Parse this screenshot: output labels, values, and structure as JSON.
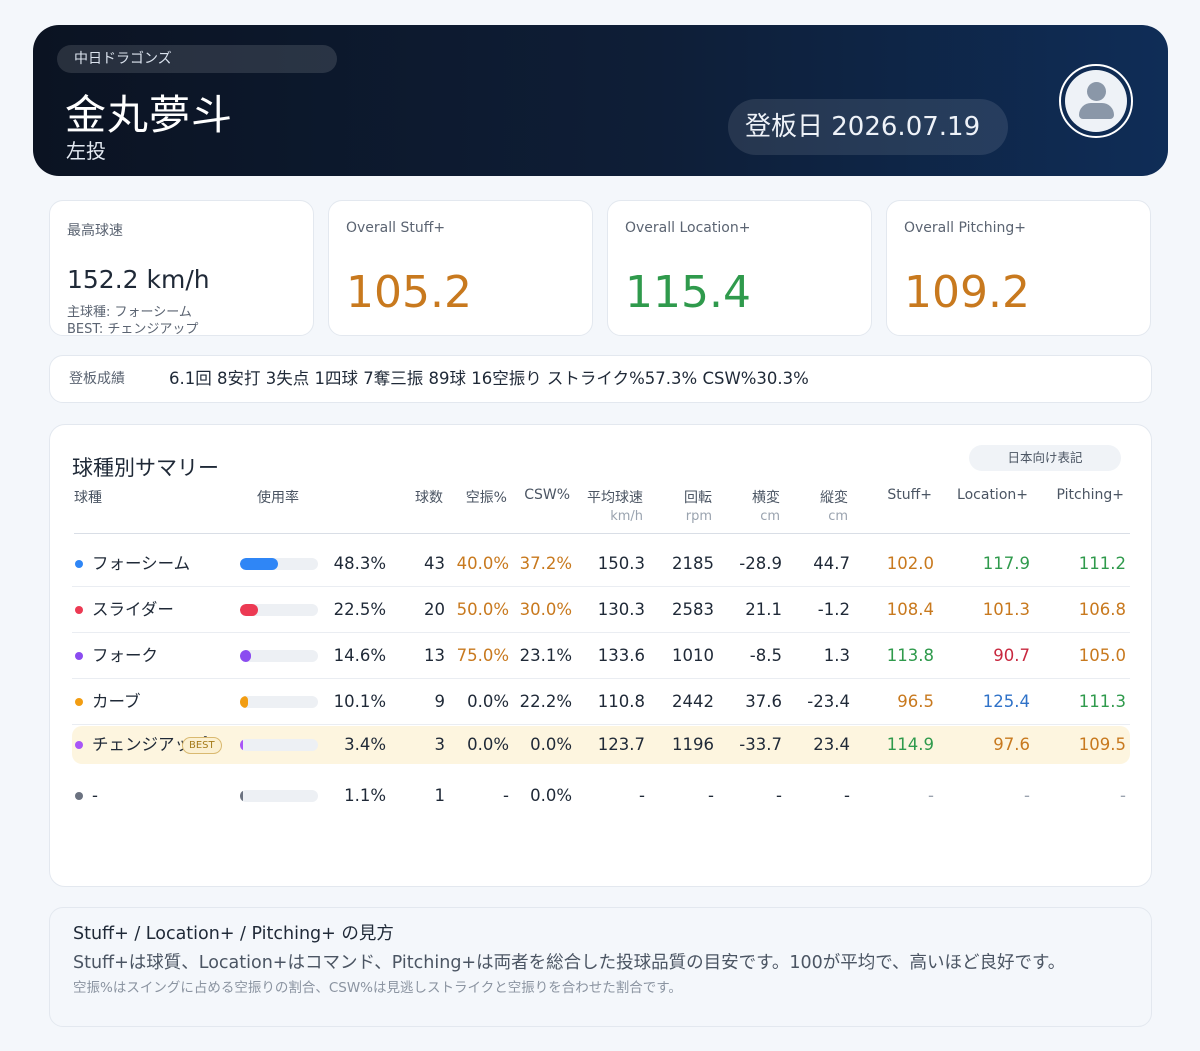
{
  "header": {
    "team": "中日ドラゴンズ",
    "player_name": "金丸夢斗",
    "hand": "左投",
    "date_label": "登板日 2026.07.19",
    "avatar_icon": "user-avatar-icon"
  },
  "stats": {
    "top_speed_label": "最高球速",
    "top_speed_value": "152.2 km/h",
    "main_pitch": "主球種: フォーシーム",
    "best_pitch": "BEST: チェンジアップ",
    "stuff_label": "Overall Stuff+",
    "stuff_value": "105.2",
    "location_label": "Overall Location+",
    "location_value": "115.4",
    "pitching_label": "Overall Pitching+",
    "pitching_value": "109.2"
  },
  "result": {
    "label": "登板成績",
    "text": "6.1回 8安打 3失点 1四球 7奪三振 89球 16空振り ストライク%57.3% CSW%30.3%"
  },
  "summary": {
    "title": "球種別サマリー",
    "notation_button": "日本向け表記",
    "columns": {
      "pitch": "球種",
      "usage": "使用率",
      "count": "球数",
      "whiff": "空振%",
      "csw": "CSW%",
      "velo": "平均球速",
      "velo_unit": "km/h",
      "spin": "回転",
      "spin_unit": "rpm",
      "hbreak": "横変",
      "hbreak_unit": "cm",
      "vbreak": "縦変",
      "vbreak_unit": "cm",
      "stuff": "Stuff+",
      "location": "Location+",
      "pitching": "Pitching+"
    },
    "best_badge": "BEST",
    "rows": [
      {
        "name": "フォーシーム",
        "color": "#2f86f6",
        "usage_fraction": 0.483,
        "usage": "48.3%",
        "count": "43",
        "whiff": "40.0%",
        "csw": "37.2%",
        "velo": "150.3",
        "spin": "2185",
        "hbreak": "-28.9",
        "vbreak": "44.7",
        "stuff": "102.0",
        "location": "117.9",
        "pitching": "111.2"
      },
      {
        "name": "スライダー",
        "color": "#ec3a53",
        "usage_fraction": 0.225,
        "usage": "22.5%",
        "count": "20",
        "whiff": "50.0%",
        "csw": "30.0%",
        "velo": "130.3",
        "spin": "2583",
        "hbreak": "21.1",
        "vbreak": "-1.2",
        "stuff": "108.4",
        "location": "101.3",
        "pitching": "106.8"
      },
      {
        "name": "フォーク",
        "color": "#8b4cf0",
        "usage_fraction": 0.146,
        "usage": "14.6%",
        "count": "13",
        "whiff": "75.0%",
        "csw": "23.1%",
        "velo": "133.6",
        "spin": "1010",
        "hbreak": "-8.5",
        "vbreak": "1.3",
        "stuff": "113.8",
        "location": "90.7",
        "pitching": "105.0"
      },
      {
        "name": "カーブ",
        "color": "#f29d12",
        "usage_fraction": 0.101,
        "usage": "10.1%",
        "count": "9",
        "whiff": "0.0%",
        "csw": "22.2%",
        "velo": "110.8",
        "spin": "2442",
        "hbreak": "37.6",
        "vbreak": "-23.4",
        "stuff": "96.5",
        "location": "125.4",
        "pitching": "111.3"
      },
      {
        "name": "チェンジアップ",
        "color": "#a855f7",
        "usage_fraction": 0.034,
        "usage": "3.4%",
        "count": "3",
        "whiff": "0.0%",
        "csw": "0.0%",
        "velo": "123.7",
        "spin": "1196",
        "hbreak": "-33.7",
        "vbreak": "23.4",
        "stuff": "114.9",
        "location": "97.6",
        "pitching": "109.5"
      },
      {
        "name": "-",
        "color": "#6b7280",
        "usage_fraction": 0.011,
        "usage": "1.1%",
        "count": "1",
        "whiff": "-",
        "csw": "0.0%",
        "velo": "-",
        "spin": "-",
        "hbreak": "-",
        "vbreak": "-",
        "stuff": "-",
        "location": "-",
        "pitching": "-"
      }
    ]
  },
  "explanation": {
    "title": "Stuff+ / Location+ / Pitching+ の見方",
    "body": "Stuff+は球質、Location+はコマンド、Pitching+は両者を総合した投球品質の目安です。100が平均で、高いほど良好です。",
    "note": "空振%はスイングに占める空振りの割合、CSW%は見逃しストライクと空振りを合わせた割合です。"
  },
  "colors": {
    "orange": "#c8791e",
    "green": "#2f9a4c",
    "red": "#c8283f",
    "blue": "#2f72c8",
    "header_bg": "#0e1e37"
  }
}
